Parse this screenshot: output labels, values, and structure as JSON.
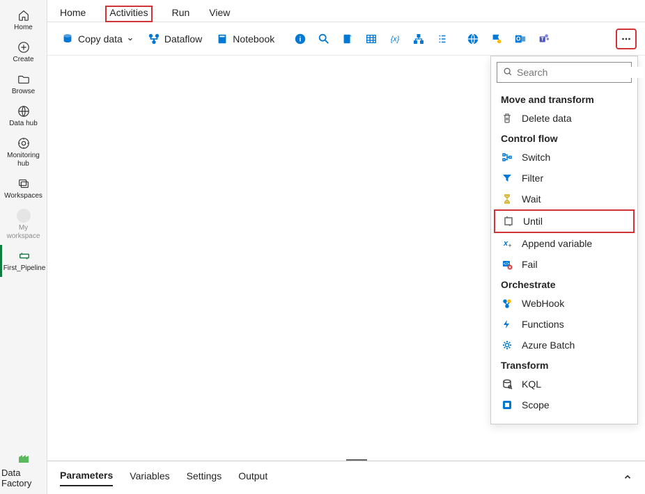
{
  "sidebar": {
    "items": [
      {
        "label": "Home",
        "icon": "home"
      },
      {
        "label": "Create",
        "icon": "plus-circle"
      },
      {
        "label": "Browse",
        "icon": "folder"
      },
      {
        "label": "Data hub",
        "icon": "globe"
      },
      {
        "label": "Monitoring hub",
        "icon": "eye-circle"
      },
      {
        "label": "Workspaces",
        "icon": "layers"
      },
      {
        "label": "My workspace",
        "icon": "avatar"
      },
      {
        "label": "First_Pipeline",
        "icon": "pipeline"
      }
    ],
    "footer": {
      "label": "Data Factory",
      "icon": "data-factory"
    }
  },
  "tabs": [
    "Home",
    "Activities",
    "Run",
    "View"
  ],
  "active_tab": "Activities",
  "toolbar": {
    "copy_data": "Copy data",
    "dataflow": "Dataflow",
    "notebook": "Notebook"
  },
  "panel": {
    "search_placeholder": "Search",
    "sections": [
      {
        "title": "Move and transform",
        "items": [
          {
            "label": "Delete data",
            "icon": "trash"
          }
        ]
      },
      {
        "title": "Control flow",
        "items": [
          {
            "label": "Switch",
            "icon": "switch"
          },
          {
            "label": "Filter",
            "icon": "funnel"
          },
          {
            "label": "Wait",
            "icon": "hourglass"
          },
          {
            "label": "Until",
            "icon": "until",
            "highlighted": true
          },
          {
            "label": "Append variable",
            "icon": "append-var"
          },
          {
            "label": "Fail",
            "icon": "fail"
          }
        ]
      },
      {
        "title": "Orchestrate",
        "items": [
          {
            "label": "WebHook",
            "icon": "webhook"
          },
          {
            "label": "Functions",
            "icon": "functions"
          },
          {
            "label": "Azure Batch",
            "icon": "gear"
          }
        ]
      },
      {
        "title": "Transform",
        "items": [
          {
            "label": "KQL",
            "icon": "kql"
          },
          {
            "label": "Scope",
            "icon": "scope"
          }
        ]
      }
    ]
  },
  "bottom_tabs": [
    "Parameters",
    "Variables",
    "Settings",
    "Output"
  ],
  "active_bottom_tab": "Parameters"
}
